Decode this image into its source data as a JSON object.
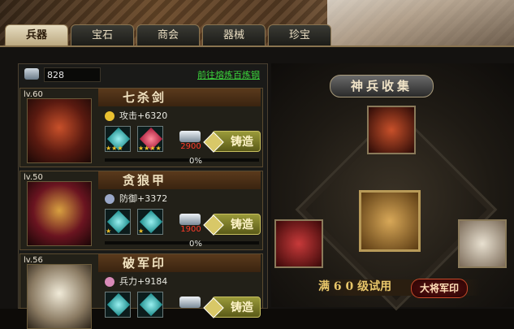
{
  "tabs": [
    {
      "label": "兵器",
      "active": true
    },
    {
      "label": "宝石",
      "active": false
    },
    {
      "label": "商会",
      "active": false
    },
    {
      "label": "器械",
      "active": false
    },
    {
      "label": "珍宝",
      "active": false
    }
  ],
  "resource": {
    "icon": "ore-icon",
    "value": "828",
    "link": "前往熔炼百炼钢"
  },
  "items": [
    {
      "level": "lv.60",
      "name": "七杀剑",
      "stat_icon": "attack-icon",
      "stat": "攻击+6320",
      "gem_stars": [
        "★★★",
        "★★★★"
      ],
      "cost": "2900",
      "forge": "铸造",
      "progress": "0%"
    },
    {
      "level": "lv.50",
      "name": "贪狼甲",
      "stat_icon": "defense-icon",
      "stat": "防御+3372",
      "gem_stars": [
        "★",
        "★"
      ],
      "cost": "1900",
      "forge": "铸造",
      "progress": "0%"
    },
    {
      "level": "lv.56",
      "name": "破军印",
      "stat_icon": "troops-icon",
      "stat": "兵力+9184",
      "gem_stars": [],
      "cost": "",
      "forge": "铸造",
      "progress": ""
    }
  ],
  "collection": {
    "title": "神兵收集",
    "trial_text": "满 6 0 级试用",
    "trial_badge": "大将军印"
  },
  "colors": {
    "accent_gold": "#e8c66a",
    "link_green": "#3cd63c",
    "cost_red": "#ff3b2a"
  }
}
